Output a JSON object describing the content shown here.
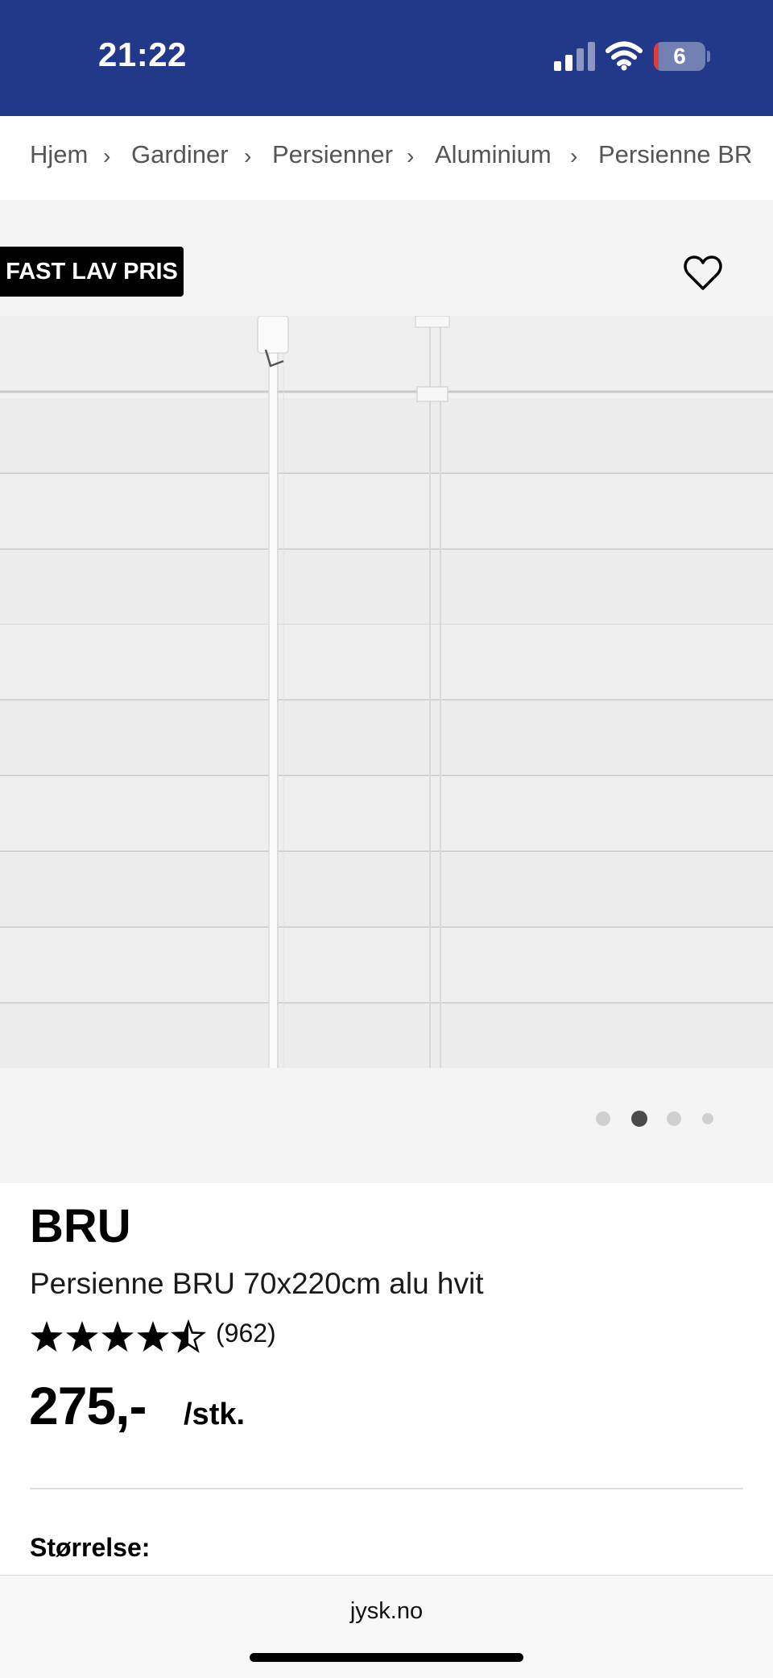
{
  "status_bar": {
    "time": "21:22",
    "battery_level": "6",
    "icons": [
      "signal-icon",
      "wifi-icon",
      "battery-icon"
    ]
  },
  "breadcrumb": {
    "items": [
      "Hjem",
      "Gardiner",
      "Persienner",
      "Aluminium",
      "Persienne BR"
    ],
    "separator": "›"
  },
  "gallery": {
    "badge": "FAST LAV PRIS",
    "favorite_icon": "heart-icon",
    "slide_count": 4,
    "active_slide": 2
  },
  "product": {
    "brand": "BRU",
    "name": "Persienne BRU 70x220cm alu hvit",
    "rating": 4.5,
    "rating_max": 5,
    "review_count": "(962)",
    "price": "275,-",
    "unit": "/stk."
  },
  "size": {
    "label": "Størrelse:"
  },
  "browser": {
    "url": "jysk.no"
  }
}
